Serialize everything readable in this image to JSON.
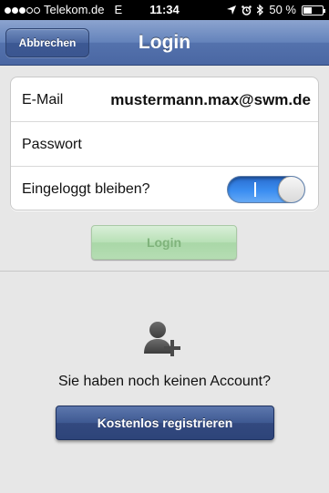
{
  "status_bar": {
    "carrier": "Telekom.de",
    "network": "E",
    "time": "11:34",
    "battery_percent": "50 %",
    "battery_level": 0.5,
    "icons": [
      "location-arrow-icon",
      "alarm-clock-icon",
      "bluetooth-icon",
      "battery-icon"
    ]
  },
  "nav": {
    "back_label": "Abbrechen",
    "title": "Login"
  },
  "form": {
    "email_label": "E-Mail",
    "email_value": "mustermann.max@swm.de",
    "password_label": "Passwort",
    "password_placeholder": "",
    "remember_label": "Eingeloggt bleiben?",
    "remember_on": true
  },
  "login_button_label": "Login",
  "register": {
    "prompt": "Sie haben noch keinen Account?",
    "button_label": "Kostenlos registrieren"
  },
  "colors": {
    "nav_blue": "#5472ad",
    "toggle_blue": "#3b8ef1",
    "login_green": "#b8e0b6",
    "register_blue": "#3e5992"
  }
}
